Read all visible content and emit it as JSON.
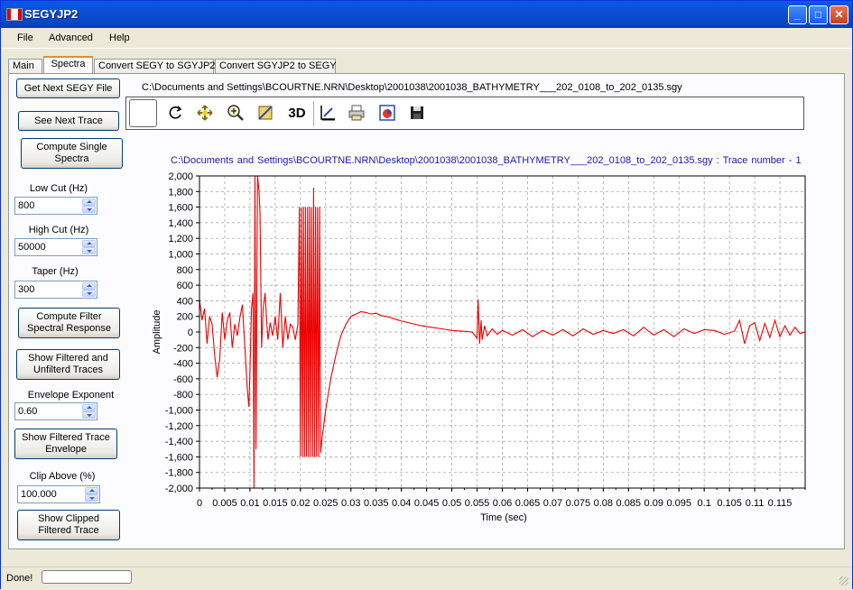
{
  "window": {
    "title": "SEGYJP2"
  },
  "menu": {
    "items": [
      "File",
      "Advanced",
      "Help"
    ]
  },
  "tabs": [
    "Main",
    "Spectra",
    "Convert SEGY to SGYJP2",
    "Convert SGYJP2 to SEGY"
  ],
  "active_tab": "Spectra",
  "left_panel": {
    "get_next_label": "Get Next SEGY File",
    "see_next_label": "See Next Trace",
    "compute_single_label_1": "Compute Single",
    "compute_single_label_2": "Spectra",
    "low_cut_label": "Low Cut (Hz)",
    "low_cut_value": "800",
    "high_cut_label": "High Cut (Hz)",
    "high_cut_value": "50000",
    "taper_label": "Taper (Hz)",
    "taper_value": "300",
    "compute_filter_label_1": "Compute Filter",
    "compute_filter_label_2": "Spectral Response",
    "show_filtered_label_1": "Show Filtered and",
    "show_filtered_label_2": "Unfilterd Traces",
    "envelope_exp_label": "Envelope Exponent",
    "envelope_exp_value": "0.60",
    "show_envelope_label_1": "Show Filtered Trace",
    "show_envelope_label_2": "Envelope",
    "clip_above_label": "Clip Above (%)",
    "clip_above_value": "100.000",
    "show_clipped_label_1": "Show Clipped",
    "show_clipped_label_2": "Filtered Trace"
  },
  "file_path": "C:\\Documents and Settings\\BCOURTNE.NRN\\Desktop\\2001038\\2001038_BATHYMETRY___202_0108_to_202_0135.sgy",
  "toolbar": {
    "threed_label": "3D",
    "icons": [
      "rotate-icon",
      "pan-icon",
      "zoom-icon",
      "save-image-icon",
      "3d-icon",
      "axes-edit-icon",
      "print-icon",
      "export-icon",
      "save-icon"
    ]
  },
  "status": {
    "text": "Done!"
  },
  "chart_data": {
    "type": "line",
    "title": "C:\\Documents and Settings\\BCOURTNE.NRN\\Desktop\\2001038\\2001038_BATHYMETRY___202_0108_to_202_0135.sgy : Trace number - 1",
    "xlabel": "Time (sec)",
    "ylabel": "Amplitude",
    "xlim": [
      0,
      0.12
    ],
    "ylim": [
      -2000,
      2000
    ],
    "x_ticks": [
      "0",
      "0.005",
      "0.01",
      "0.015",
      "0.02",
      "0.025",
      "0.03",
      "0.035",
      "0.04",
      "0.045",
      "0.05",
      "0.055",
      "0.06",
      "0.065",
      "0.07",
      "0.075",
      "0.08",
      "0.085",
      "0.09",
      "0.095",
      "0.1",
      "0.105",
      "0.11",
      "0.115"
    ],
    "y_ticks": [
      "2,000",
      "1,800",
      "1,600",
      "1,400",
      "1,200",
      "1,000",
      "800",
      "600",
      "400",
      "200",
      "0",
      "-200",
      "-400",
      "-600",
      "-800",
      "-1,000",
      "-1,200",
      "-1,400",
      "-1,600",
      "-1,800",
      "-2,000"
    ],
    "grid": true,
    "series": [
      {
        "color": "#ee0000",
        "x": [
          0,
          0.0005,
          0.001,
          0.0015,
          0.002,
          0.0025,
          0.003,
          0.0035,
          0.004,
          0.0045,
          0.005,
          0.0055,
          0.006,
          0.0065,
          0.007,
          0.0075,
          0.008,
          0.0085,
          0.009,
          0.0095,
          0.0098,
          0.01,
          0.0103,
          0.0106,
          0.0108,
          0.011,
          0.0112,
          0.0115,
          0.0118,
          0.012,
          0.0123,
          0.0126,
          0.013,
          0.0133,
          0.0136,
          0.014,
          0.0145,
          0.015,
          0.0155,
          0.016,
          0.0165,
          0.017,
          0.0175,
          0.018,
          0.0185,
          0.019,
          0.0195,
          0.0198,
          0.02,
          0.0202,
          0.0204,
          0.0206,
          0.0208,
          0.021,
          0.0212,
          0.0214,
          0.0216,
          0.0218,
          0.022,
          0.0222,
          0.0224,
          0.0226,
          0.0228,
          0.023,
          0.0232,
          0.0234,
          0.0236,
          0.0238,
          0.024,
          0.0243,
          0.0246,
          0.025,
          0.026,
          0.027,
          0.028,
          0.029,
          0.03,
          0.031,
          0.032,
          0.033,
          0.034,
          0.035,
          0.036,
          0.037,
          0.038,
          0.039,
          0.04,
          0.042,
          0.044,
          0.046,
          0.048,
          0.05,
          0.052,
          0.054,
          0.055,
          0.0552,
          0.0555,
          0.0558,
          0.056,
          0.0565,
          0.057,
          0.058,
          0.059,
          0.06,
          0.062,
          0.064,
          0.066,
          0.068,
          0.07,
          0.072,
          0.074,
          0.076,
          0.078,
          0.08,
          0.082,
          0.084,
          0.086,
          0.088,
          0.09,
          0.092,
          0.094,
          0.096,
          0.098,
          0.1,
          0.102,
          0.104,
          0.106,
          0.107,
          0.108,
          0.109,
          0.11,
          0.111,
          0.112,
          0.113,
          0.114,
          0.115,
          0.116,
          0.117,
          0.118,
          0.119,
          0.12
        ],
        "y": [
          420,
          150,
          300,
          -150,
          200,
          100,
          -300,
          -580,
          -350,
          250,
          -100,
          150,
          250,
          -200,
          100,
          -50,
          180,
          350,
          -200,
          -750,
          -960,
          -500,
          300,
          500,
          -2000,
          2000,
          -1500,
          2000,
          1800,
          1500,
          -200,
          300,
          500,
          150,
          -100,
          120,
          -50,
          200,
          -100,
          500,
          -200,
          200,
          -100,
          100,
          60,
          -100,
          100,
          1600,
          -1600,
          1600,
          -1600,
          1600,
          -1600,
          1600,
          -1600,
          1600,
          -1600,
          1600,
          -1600,
          1600,
          -1600,
          1850,
          -1600,
          1600,
          -1600,
          1600,
          -1600,
          1600,
          -1550,
          -1350,
          -1200,
          -1000,
          -600,
          -300,
          -50,
          100,
          200,
          230,
          260,
          250,
          230,
          240,
          210,
          200,
          180,
          160,
          140,
          110,
          80,
          60,
          40,
          20,
          10,
          0,
          -80,
          420,
          -150,
          150,
          -100,
          80,
          -50,
          40,
          -30,
          20,
          -40,
          30,
          -60,
          20,
          -40,
          30,
          -50,
          40,
          -30,
          20,
          -20,
          30,
          -50,
          60,
          -40,
          30,
          -60,
          40,
          -20,
          30,
          20,
          -30,
          10,
          150,
          -150,
          80,
          120,
          -110,
          110,
          -70,
          150,
          -60,
          80,
          -40,
          60,
          -20,
          0
        ]
      }
    ]
  }
}
